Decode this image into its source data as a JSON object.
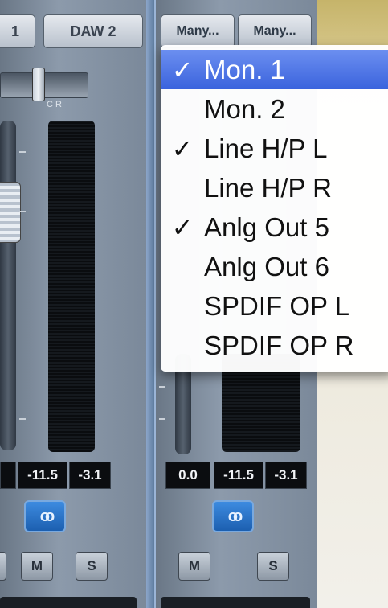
{
  "strips": {
    "left": {
      "header_a": "1",
      "header_b": "DAW 2",
      "pan_scale": "C    R",
      "readouts": [
        "-11.5",
        "-3.1"
      ],
      "mute_label": "M",
      "solo_label": "S"
    },
    "right": {
      "header_a": "Many...",
      "header_b": "Many...",
      "readouts": [
        "0.0",
        "-11.5",
        "-3.1"
      ],
      "mute_label": "M",
      "solo_label": "S"
    }
  },
  "link_symbol": "oo",
  "menu": {
    "items": [
      {
        "label": "Mon. 1",
        "checked": "✓",
        "selected": true
      },
      {
        "label": "Mon. 2",
        "checked": "",
        "selected": false
      },
      {
        "label": "Line H/P L",
        "checked": "✓",
        "selected": false
      },
      {
        "label": "Line H/P R",
        "checked": "",
        "selected": false
      },
      {
        "label": "Anlg Out 5",
        "checked": "✓",
        "selected": false
      },
      {
        "label": "Anlg Out 6",
        "checked": "",
        "selected": false
      },
      {
        "label": "SPDIF OP L",
        "checked": "",
        "selected": false
      },
      {
        "label": "SPDIF OP R",
        "checked": "",
        "selected": false
      }
    ]
  },
  "colors": {
    "selection": "#3a63dd",
    "link_button": "#1c5fb0",
    "meter_bg": "#0a0c0f"
  }
}
